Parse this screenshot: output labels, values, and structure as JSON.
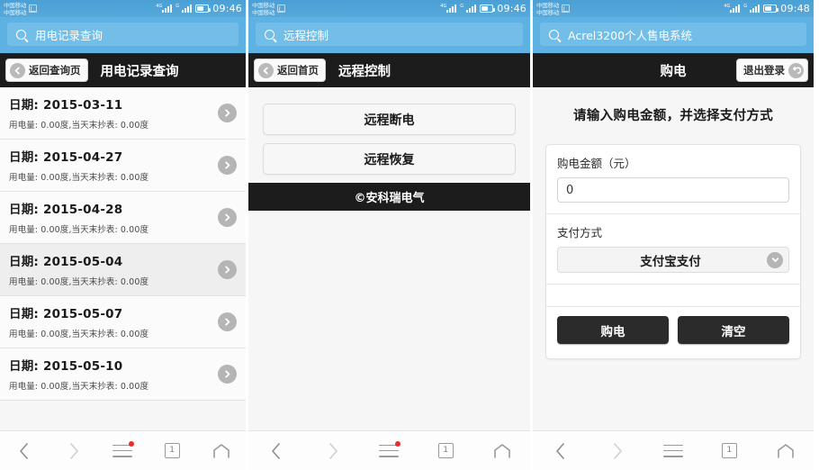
{
  "status_bar": {
    "carrier_line1": "中国移动",
    "carrier_line2": "中国移动",
    "sim_icon": "sim-card-icon",
    "signal_1_label": "4G",
    "signal_2_label": "G",
    "battery_icon": "battery-icon",
    "time_panel1": "09:46",
    "time_panel2": "09:46",
    "time_panel3": "09:48"
  },
  "panel1": {
    "url": "用电记录查询",
    "search_icon": "search-icon",
    "back_button": "返回查询页",
    "back_icon": "circle-arrow-left-icon",
    "title": "用电记录查询",
    "rows": [
      {
        "date_label": "日期:",
        "date": "2015-03-11",
        "detail": "用电量: 0.00度,当天末抄表: 0.00度"
      },
      {
        "date_label": "日期:",
        "date": "2015-04-27",
        "detail": "用电量: 0.00度,当天末抄表: 0.00度"
      },
      {
        "date_label": "日期:",
        "date": "2015-04-28",
        "detail": "用电量: 0.00度,当天末抄表: 0.00度"
      },
      {
        "date_label": "日期:",
        "date": "2015-05-04",
        "detail": "用电量: 0.00度,当天末抄表: 0.00度"
      },
      {
        "date_label": "日期:",
        "date": "2015-05-07",
        "detail": "用电量: 0.00度,当天末抄表: 0.00度"
      },
      {
        "date_label": "日期:",
        "date": "2015-05-10",
        "detail": "用电量: 0.00度,当天末抄表: 0.00度"
      }
    ]
  },
  "panel2": {
    "url": "远程控制",
    "search_icon": "search-icon",
    "back_button": "返回首页",
    "back_icon": "circle-arrow-left-icon",
    "title": "远程控制",
    "button_disconnect": "远程断电",
    "button_restore": "远程恢复",
    "footer": "©安科瑞电气"
  },
  "panel3": {
    "url": "Acrel3200个人售电系统",
    "search_icon": "search-icon",
    "title": "购电",
    "logout_button": "退出登录",
    "logout_icon": "circle-arrow-back-icon",
    "heading": "请输入购电金额，并选择支付方式",
    "amount_label": "购电金额（元）",
    "amount_value": "0",
    "amount_placeholder": "0",
    "payment_label": "支付方式",
    "payment_selected": "支付宝支付",
    "payment_caret_icon": "chevron-down-icon",
    "button_buy": "购电",
    "button_clear": "清空"
  },
  "bottom_nav": {
    "back_icon": "chevron-left-icon",
    "forward_icon": "chevron-right-icon",
    "menu_icon": "hamburger-menu-icon",
    "menu_badge": true,
    "tabs_icon": "tab-count-icon",
    "tabs_count": "1",
    "home_icon": "home-icon"
  },
  "colors": {
    "accent_blue": "#5db2e3",
    "status_blue": "#4a9fd4",
    "appbar_black": "#1c1c1c",
    "badge_red": "#ee2b2b",
    "button_dark": "#2b2b2b"
  }
}
